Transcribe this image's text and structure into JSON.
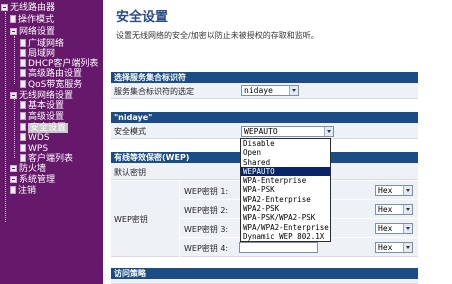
{
  "sidebar": {
    "items": [
      {
        "label": "无线路由器",
        "kind": "folder"
      },
      {
        "label": "操作模式",
        "kind": "doc"
      },
      {
        "label": "网络设置",
        "kind": "folder"
      },
      {
        "label": "广域网络",
        "kind": "doc"
      },
      {
        "label": "局域网",
        "kind": "doc"
      },
      {
        "label": "DHCP客户端列表",
        "kind": "doc"
      },
      {
        "label": "高级路由设置",
        "kind": "doc"
      },
      {
        "label": "QoS带宽服务",
        "kind": "doc"
      },
      {
        "label": "无线网络设置",
        "kind": "folder"
      },
      {
        "label": "基本设置",
        "kind": "doc"
      },
      {
        "label": "高级设置",
        "kind": "doc"
      },
      {
        "label": "安全设置",
        "kind": "doc",
        "active": true
      },
      {
        "label": "WDS",
        "kind": "doc"
      },
      {
        "label": "WPS",
        "kind": "doc"
      },
      {
        "label": "客户端列表",
        "kind": "doc"
      },
      {
        "label": "防火墙",
        "kind": "folder"
      },
      {
        "label": "系统管理",
        "kind": "folder"
      },
      {
        "label": "注销",
        "kind": "doc"
      }
    ]
  },
  "main": {
    "title": "安全设置",
    "description": "设置无线网络的安全/加密以防止未被授权的存取和监听。",
    "ssid_section": {
      "header": "选择服务集合标识符",
      "label": "服务集合标识符的选定",
      "value": "nidaye"
    },
    "ssid_header": "\"nidaye\"",
    "security_mode": {
      "label": "安全模式",
      "value": "WEPAUTO"
    },
    "dropdown_options": [
      "Disable",
      "Open",
      "Shared",
      "WEPAUTO",
      "WPA-Enterprise",
      "WPA-PSK",
      "WPA2-Enterprise",
      "WPA2-PSK",
      "WPA-PSK/WPA2-PSK",
      "WPA/WPA2-Enterprise",
      "Dynamic WEP 802.1X"
    ],
    "wep_section": {
      "header": "有线等效保密(WEP)",
      "default_key_label": "默认密钥",
      "wep_label": "WEP密钥",
      "keys": [
        {
          "label": "WEP密钥 1:",
          "format": "Hex"
        },
        {
          "label": "WEP密钥 2:",
          "format": "Hex"
        },
        {
          "label": "WEP密钥 3:",
          "format": "Hex"
        },
        {
          "label": "WEP密钥 4:",
          "format": "Hex"
        }
      ]
    },
    "access_policy_header": "访问策略"
  }
}
